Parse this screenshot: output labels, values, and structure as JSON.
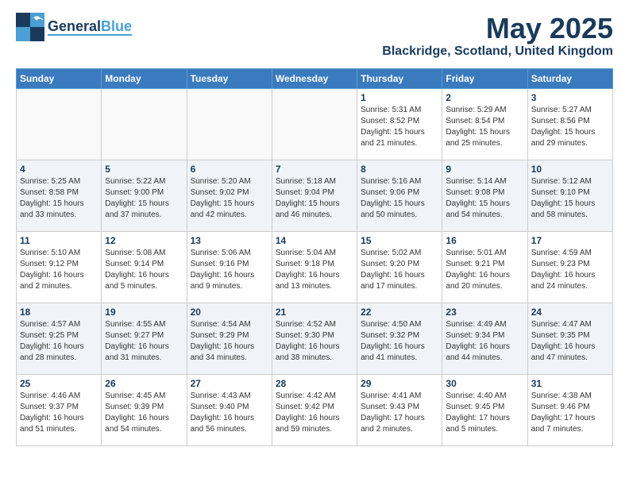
{
  "header": {
    "logo_general": "General",
    "logo_blue": "Blue",
    "month": "May 2025",
    "location": "Blackridge, Scotland, United Kingdom"
  },
  "days_of_week": [
    "Sunday",
    "Monday",
    "Tuesday",
    "Wednesday",
    "Thursday",
    "Friday",
    "Saturday"
  ],
  "weeks": [
    [
      {
        "day": "",
        "info": ""
      },
      {
        "day": "",
        "info": ""
      },
      {
        "day": "",
        "info": ""
      },
      {
        "day": "",
        "info": ""
      },
      {
        "day": "1",
        "info": "Sunrise: 5:31 AM\nSunset: 8:52 PM\nDaylight: 15 hours\nand 21 minutes."
      },
      {
        "day": "2",
        "info": "Sunrise: 5:29 AM\nSunset: 8:54 PM\nDaylight: 15 hours\nand 25 minutes."
      },
      {
        "day": "3",
        "info": "Sunrise: 5:27 AM\nSunset: 8:56 PM\nDaylight: 15 hours\nand 29 minutes."
      }
    ],
    [
      {
        "day": "4",
        "info": "Sunrise: 5:25 AM\nSunset: 8:58 PM\nDaylight: 15 hours\nand 33 minutes."
      },
      {
        "day": "5",
        "info": "Sunrise: 5:22 AM\nSunset: 9:00 PM\nDaylight: 15 hours\nand 37 minutes."
      },
      {
        "day": "6",
        "info": "Sunrise: 5:20 AM\nSunset: 9:02 PM\nDaylight: 15 hours\nand 42 minutes."
      },
      {
        "day": "7",
        "info": "Sunrise: 5:18 AM\nSunset: 9:04 PM\nDaylight: 15 hours\nand 46 minutes."
      },
      {
        "day": "8",
        "info": "Sunrise: 5:16 AM\nSunset: 9:06 PM\nDaylight: 15 hours\nand 50 minutes."
      },
      {
        "day": "9",
        "info": "Sunrise: 5:14 AM\nSunset: 9:08 PM\nDaylight: 15 hours\nand 54 minutes."
      },
      {
        "day": "10",
        "info": "Sunrise: 5:12 AM\nSunset: 9:10 PM\nDaylight: 15 hours\nand 58 minutes."
      }
    ],
    [
      {
        "day": "11",
        "info": "Sunrise: 5:10 AM\nSunset: 9:12 PM\nDaylight: 16 hours\nand 2 minutes."
      },
      {
        "day": "12",
        "info": "Sunrise: 5:08 AM\nSunset: 9:14 PM\nDaylight: 16 hours\nand 5 minutes."
      },
      {
        "day": "13",
        "info": "Sunrise: 5:06 AM\nSunset: 9:16 PM\nDaylight: 16 hours\nand 9 minutes."
      },
      {
        "day": "14",
        "info": "Sunrise: 5:04 AM\nSunset: 9:18 PM\nDaylight: 16 hours\nand 13 minutes."
      },
      {
        "day": "15",
        "info": "Sunrise: 5:02 AM\nSunset: 9:20 PM\nDaylight: 16 hours\nand 17 minutes."
      },
      {
        "day": "16",
        "info": "Sunrise: 5:01 AM\nSunset: 9:21 PM\nDaylight: 16 hours\nand 20 minutes."
      },
      {
        "day": "17",
        "info": "Sunrise: 4:59 AM\nSunset: 9:23 PM\nDaylight: 16 hours\nand 24 minutes."
      }
    ],
    [
      {
        "day": "18",
        "info": "Sunrise: 4:57 AM\nSunset: 9:25 PM\nDaylight: 16 hours\nand 28 minutes."
      },
      {
        "day": "19",
        "info": "Sunrise: 4:55 AM\nSunset: 9:27 PM\nDaylight: 16 hours\nand 31 minutes."
      },
      {
        "day": "20",
        "info": "Sunrise: 4:54 AM\nSunset: 9:29 PM\nDaylight: 16 hours\nand 34 minutes."
      },
      {
        "day": "21",
        "info": "Sunrise: 4:52 AM\nSunset: 9:30 PM\nDaylight: 16 hours\nand 38 minutes."
      },
      {
        "day": "22",
        "info": "Sunrise: 4:50 AM\nSunset: 9:32 PM\nDaylight: 16 hours\nand 41 minutes."
      },
      {
        "day": "23",
        "info": "Sunrise: 4:49 AM\nSunset: 9:34 PM\nDaylight: 16 hours\nand 44 minutes."
      },
      {
        "day": "24",
        "info": "Sunrise: 4:47 AM\nSunset: 9:35 PM\nDaylight: 16 hours\nand 47 minutes."
      }
    ],
    [
      {
        "day": "25",
        "info": "Sunrise: 4:46 AM\nSunset: 9:37 PM\nDaylight: 16 hours\nand 51 minutes."
      },
      {
        "day": "26",
        "info": "Sunrise: 4:45 AM\nSunset: 9:39 PM\nDaylight: 16 hours\nand 54 minutes."
      },
      {
        "day": "27",
        "info": "Sunrise: 4:43 AM\nSunset: 9:40 PM\nDaylight: 16 hours\nand 56 minutes."
      },
      {
        "day": "28",
        "info": "Sunrise: 4:42 AM\nSunset: 9:42 PM\nDaylight: 16 hours\nand 59 minutes."
      },
      {
        "day": "29",
        "info": "Sunrise: 4:41 AM\nSunset: 9:43 PM\nDaylight: 17 hours\nand 2 minutes."
      },
      {
        "day": "30",
        "info": "Sunrise: 4:40 AM\nSunset: 9:45 PM\nDaylight: 17 hours\nand 5 minutes."
      },
      {
        "day": "31",
        "info": "Sunrise: 4:38 AM\nSunset: 9:46 PM\nDaylight: 17 hours\nand 7 minutes."
      }
    ]
  ]
}
